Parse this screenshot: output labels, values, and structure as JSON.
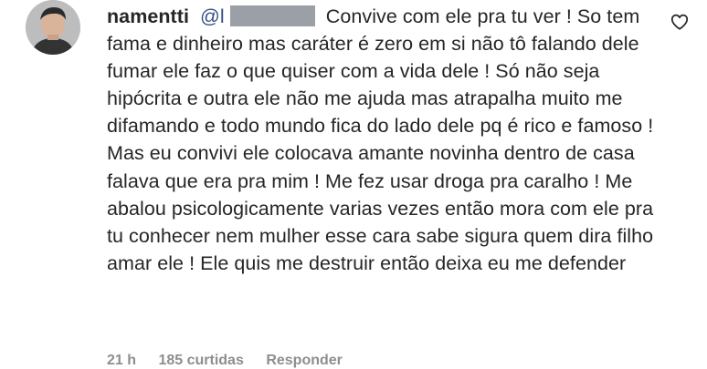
{
  "comment": {
    "username": "namentti",
    "mention_prefix": "@l",
    "text": "Convive com ele pra tu ver ! So tem fama e dinheiro mas caráter é zero em si não tô falando dele fumar ele faz o que quiser com a vida dele ! Só não seja hipócrita e outra ele não me ajuda mas atrapalha muito me difamando e todo mundo fica do lado dele pq é rico e famoso ! Mas eu convivi ele colocava amante novinha dentro de casa falava que era pra mim ! Me fez usar droga pra caralho ! Me abalou psicologicamente varias vezes então mora com ele pra tu conhecer nem mulher esse cara sabe sigura quem dira filho amar ele ! Ele quis me destruir então deixa eu me defender",
    "time": "21 h",
    "likes": "185 curtidas",
    "reply_label": "Responder",
    "icons": {
      "like": "heart-outline-icon",
      "avatar": "profile-photo"
    },
    "colors": {
      "mention": "#385185",
      "meta": "#8e8e8e",
      "text": "#262626"
    }
  }
}
